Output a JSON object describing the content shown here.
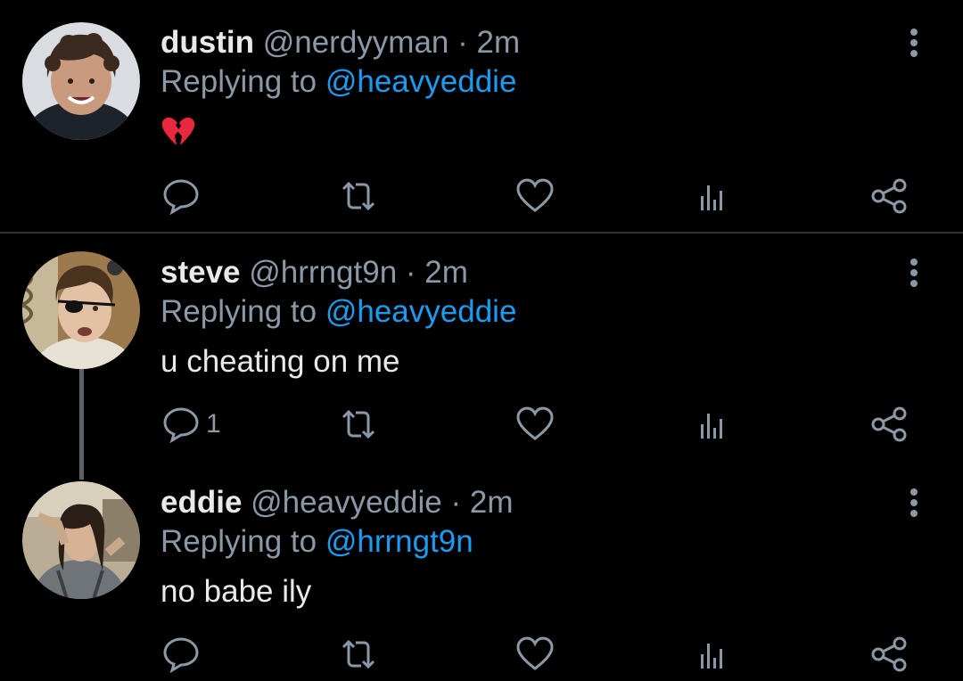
{
  "tweets": [
    {
      "name": "dustin",
      "handle": "@nerdyyman",
      "separator": "·",
      "time": "2m",
      "replying_prefix": "Replying to",
      "replying_to": "@heavyeddie",
      "text": "",
      "emoji": "broken-heart-icon",
      "reply_count": "",
      "avatar": "avatar-photo-curly-hair-boy"
    },
    {
      "name": "steve",
      "handle": "@hrrngt9n",
      "separator": "·",
      "time": "2m",
      "replying_prefix": "Replying to",
      "replying_to": "@heavyeddie",
      "text": "u cheating on me",
      "reply_count": "1",
      "avatar": "avatar-photo-eyepatch"
    },
    {
      "name": "eddie",
      "handle": "@heavyeddie",
      "separator": "·",
      "time": "2m",
      "replying_prefix": "Replying to",
      "replying_to": "@hrrngt9n",
      "text": "no babe ily",
      "reply_count": "",
      "avatar": "avatar-photo-long-hair"
    }
  ],
  "icons": {
    "reply": "reply-icon",
    "retweet": "retweet-icon",
    "like": "heart-icon",
    "analytics": "analytics-icon",
    "share": "share-icon",
    "more": "more-vertical-icon"
  },
  "colors": {
    "background": "#000000",
    "text": "#e7e9ea",
    "secondary": "#8b98a5",
    "link": "#1d9bf0",
    "emoji": "#e8283f"
  }
}
